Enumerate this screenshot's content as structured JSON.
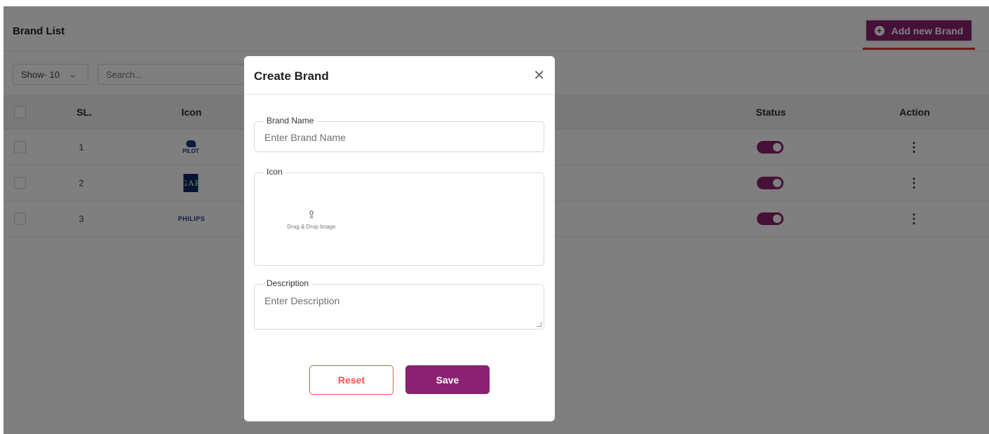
{
  "header": {
    "title": "Brand List",
    "add_button_label": "Add new Brand"
  },
  "filters": {
    "show_value": "Show- 10",
    "search_placeholder": "Search..."
  },
  "table": {
    "columns": {
      "sl": "SL.",
      "icon": "Icon",
      "status": "Status",
      "action": "Action"
    },
    "rows": [
      {
        "sl": "1",
        "logo": "PILOT",
        "status_on": true
      },
      {
        "sl": "2",
        "logo": "GAP",
        "status_on": true
      },
      {
        "sl": "3",
        "logo": "PHILIPS",
        "status_on": true
      }
    ]
  },
  "modal": {
    "title": "Create Brand",
    "brand_name": {
      "label": "Brand Name",
      "placeholder": "Enter Brand Name"
    },
    "icon": {
      "label": "Icon",
      "upload_text": "Drag & Drop Image"
    },
    "description": {
      "label": "Description",
      "placeholder": "Enter Description"
    },
    "reset_label": "Reset",
    "save_label": "Save"
  },
  "colors": {
    "brand": "#8a2271",
    "danger": "#ff4d4f",
    "overlay": "rgba(0,0,0,0.5)"
  }
}
